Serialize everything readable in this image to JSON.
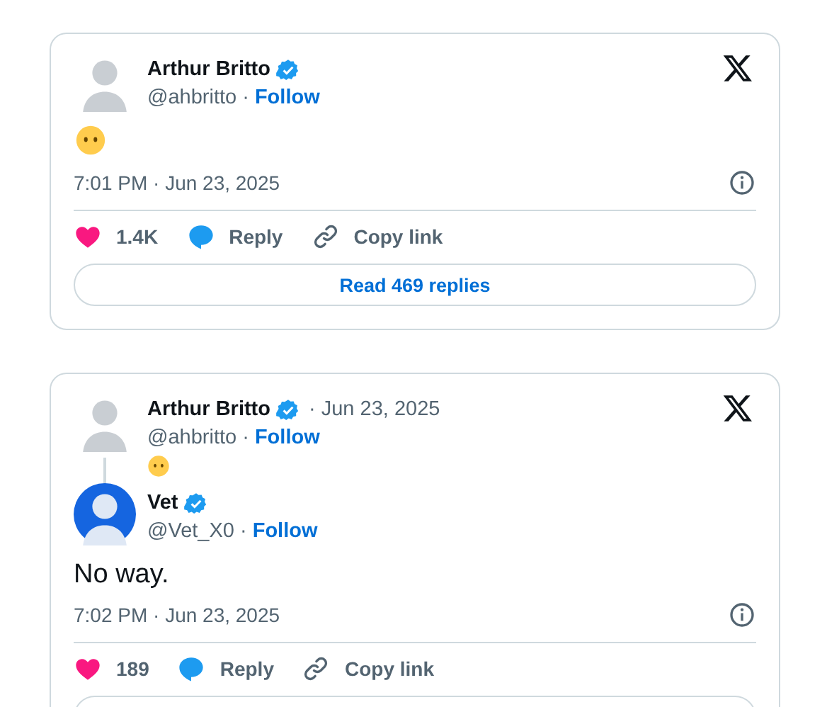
{
  "posts": [
    {
      "author": {
        "name": "Arthur Britto",
        "verified": true,
        "handle": "@ahbritto ·",
        "follow": "Follow"
      },
      "body": {
        "kind": "emoji"
      },
      "timestamp": "7:01 PM · Jun 23, 2025",
      "likes": "1.4K",
      "reply": "Reply",
      "copy_link": "Copy link",
      "replies_button": {
        "label": "Read 469 replies"
      }
    },
    {
      "parent": {
        "name": "Arthur Britto",
        "verified": true,
        "date": "· Jun 23, 2025",
        "handle": "@ahbritto ·",
        "follow": "Follow",
        "body": {
          "kind": "emoji"
        }
      },
      "author": {
        "name": "Vet",
        "verified": true,
        "handle": "@Vet_X0 ·",
        "follow": "Follow",
        "avatar_filled": true
      },
      "body": {
        "kind": "text",
        "text": "No way."
      },
      "timestamp": "7:02 PM · Jun 23, 2025",
      "likes": "189",
      "reply": "Reply",
      "copy_link": "Copy link",
      "replies_button": {
        "label_shown": false
      }
    }
  ]
}
